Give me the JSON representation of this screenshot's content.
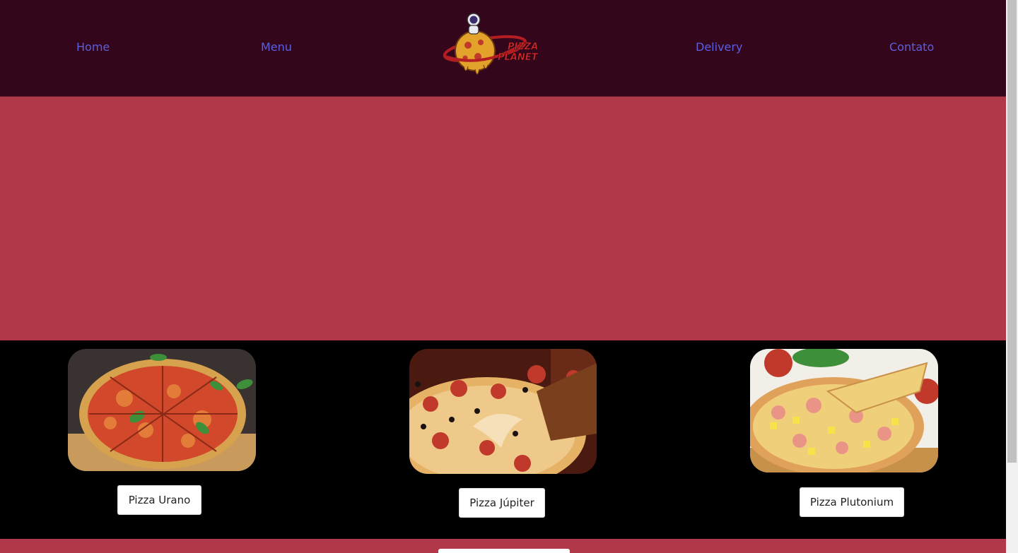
{
  "nav": {
    "home": "Home",
    "menu": "Menu",
    "delivery": "Delivery",
    "contact": "Contato"
  },
  "logo": {
    "line1": "PIZZA",
    "line2": "PLANET"
  },
  "products": [
    {
      "name": "Pizza Urano",
      "icon": "pizza-image-margherita"
    },
    {
      "name": "Pizza Júpiter",
      "icon": "pizza-image-pepperoni"
    },
    {
      "name": "Pizza Plutonium",
      "icon": "pizza-image-hawaiian"
    }
  ],
  "colors": {
    "header_bg": "#34061b",
    "hero_bg": "#b03848",
    "products_bg": "#000000",
    "nav_link": "#5b5fe0",
    "logo_text": "#d32a2a"
  }
}
